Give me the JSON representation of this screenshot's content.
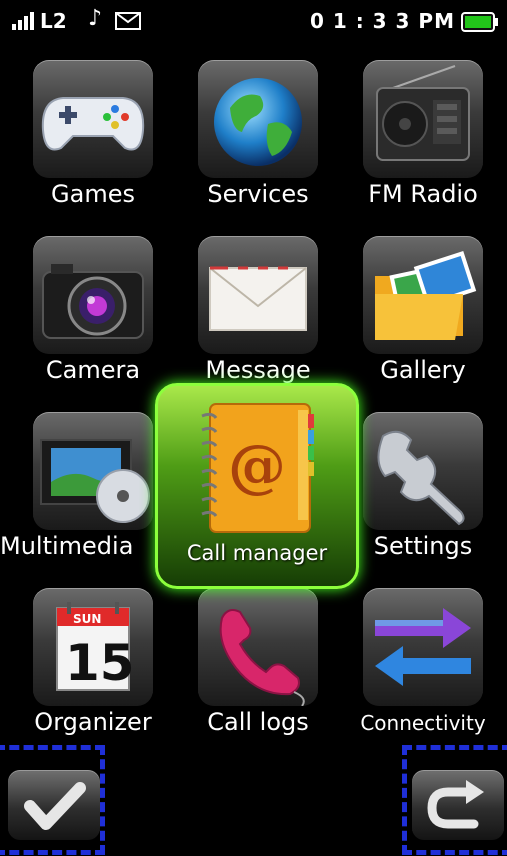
{
  "status_bar": {
    "carrier": "L2",
    "time": "0 1 : 3 3 PM",
    "icons": [
      "signal-icon",
      "music-note-icon",
      "mail-icon",
      "battery-icon"
    ],
    "battery_color": "#22c51a"
  },
  "menu": {
    "items": [
      {
        "label": "Games",
        "icon": "gamepad-icon"
      },
      {
        "label": "Services",
        "icon": "globe-icon"
      },
      {
        "label": "FM Radio",
        "icon": "radio-icon"
      },
      {
        "label": "Camera",
        "icon": "camera-icon"
      },
      {
        "label": "Message",
        "icon": "envelope-icon"
      },
      {
        "label": "Gallery",
        "icon": "photo-folder-icon"
      },
      {
        "label": "Multimedia",
        "icon": "film-disc-icon"
      },
      {
        "label": "Call manager",
        "icon": "address-book-icon",
        "selected": true
      },
      {
        "label": "Settings",
        "icon": "wrench-icon"
      },
      {
        "label": "Organizer",
        "icon": "calendar-icon",
        "calendar_day": "SUN",
        "calendar_date": "15"
      },
      {
        "label": "Call logs",
        "icon": "phone-handset-icon"
      },
      {
        "label": "Connectivity",
        "icon": "arrows-exchange-icon"
      }
    ]
  },
  "soft_keys": {
    "left": "checkmark-icon",
    "right": "back-arrow-icon"
  },
  "colors": {
    "selection_glow": "#46ff20",
    "dashed_highlight": "#1f2fd8"
  }
}
